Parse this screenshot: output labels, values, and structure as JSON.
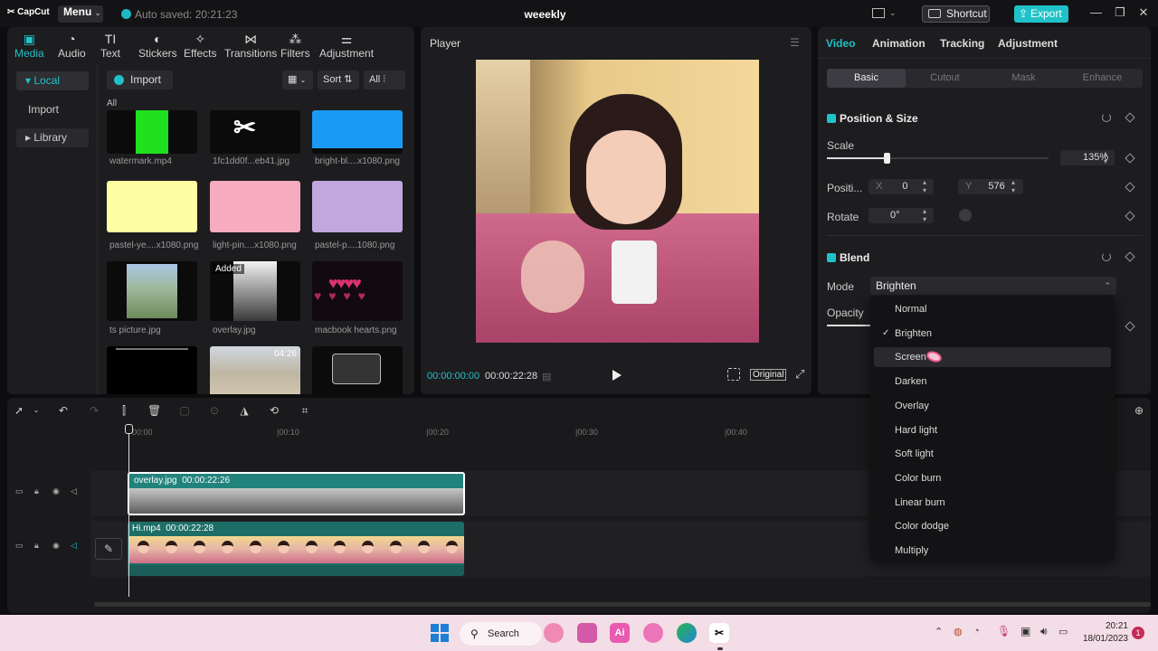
{
  "app": {
    "logo": "CapCut",
    "menu_label": "Menu",
    "autosave": "Auto saved: 20:21:23",
    "project_title": "weeekly",
    "shortcut_label": "Shortcut",
    "export_label": "Export",
    "accent": "#1fc2c8"
  },
  "left": {
    "tabs": [
      {
        "label": "Media",
        "icon": "media-icon"
      },
      {
        "label": "Audio",
        "icon": "audio-icon"
      },
      {
        "label": "Text",
        "icon": "text-icon"
      },
      {
        "label": "Stickers",
        "icon": "stickers-icon"
      },
      {
        "label": "Effects",
        "icon": "effects-icon"
      },
      {
        "label": "Transitions",
        "icon": "transitions-icon"
      },
      {
        "label": "Filters",
        "icon": "filters-icon"
      },
      {
        "label": "Adjustment",
        "icon": "adjustment-icon"
      }
    ],
    "tab_icons": [
      "▣",
      "◔",
      "TI",
      "◐",
      "✧",
      "⋈",
      "⁂",
      "⚌"
    ],
    "side": {
      "local": "Local",
      "import": "Import",
      "library": "Library"
    },
    "import_label": "Import",
    "sort_label": "Sort",
    "all_filter": "All",
    "section_all": "All",
    "added_badge": "Added",
    "media": [
      {
        "name": "watermark.mp4"
      },
      {
        "name": "1fc1dd0f...eb41.jpg"
      },
      {
        "name": "bright-bl....x1080.png"
      },
      {
        "name": "pastel-ye....x1080.png"
      },
      {
        "name": "light-pin....x1080.png"
      },
      {
        "name": "pastel-p....1080.png"
      },
      {
        "name": "ts picture.jpg"
      },
      {
        "name": "overlay.jpg"
      },
      {
        "name": "macbook hearts.png"
      }
    ],
    "clip_duration": "04:26"
  },
  "player": {
    "title": "Player",
    "time_current": "00:00:00:00",
    "time_total": "00:00:22:28",
    "original_label": "Original"
  },
  "right": {
    "tabs": [
      "Video",
      "Animation",
      "Tracking",
      "Adjustment"
    ],
    "subtabs": [
      "Basic",
      "Cutout",
      "Mask",
      "Enhance"
    ],
    "position_size": "Position & Size",
    "scale_label": "Scale",
    "scale_value": "135%",
    "scale_fraction": 0.27,
    "position_label": "Positi...",
    "x_label": "X",
    "x_value": "0",
    "y_label": "Y",
    "y_value": "576",
    "rotate_label": "Rotate",
    "rotate_value": "0°",
    "blend_label": "Blend",
    "mode_label": "Mode",
    "mode_value": "Brighten",
    "opacity_label": "Opacity"
  },
  "dropdown": {
    "items": [
      "Normal",
      "Brighten",
      "Screen",
      "Darken",
      "Overlay",
      "Hard light",
      "Soft light",
      "Color burn",
      "Linear burn",
      "Color dodge",
      "Multiply"
    ],
    "selected": "Brighten",
    "hovered": "Screen"
  },
  "timeline": {
    "ruler": [
      "00:00",
      "|00:10",
      "|00:20",
      "|00:30",
      "|00:40"
    ],
    "overlay_clip": {
      "name": "overlay.jpg",
      "duration": "00:00:22:26"
    },
    "video_clip": {
      "name": "Hi.mp4",
      "duration": "00:00:22:28"
    }
  },
  "taskbar": {
    "search_label": "Search",
    "time": "20:21",
    "date": "18/01/2023",
    "notifications": "1"
  }
}
